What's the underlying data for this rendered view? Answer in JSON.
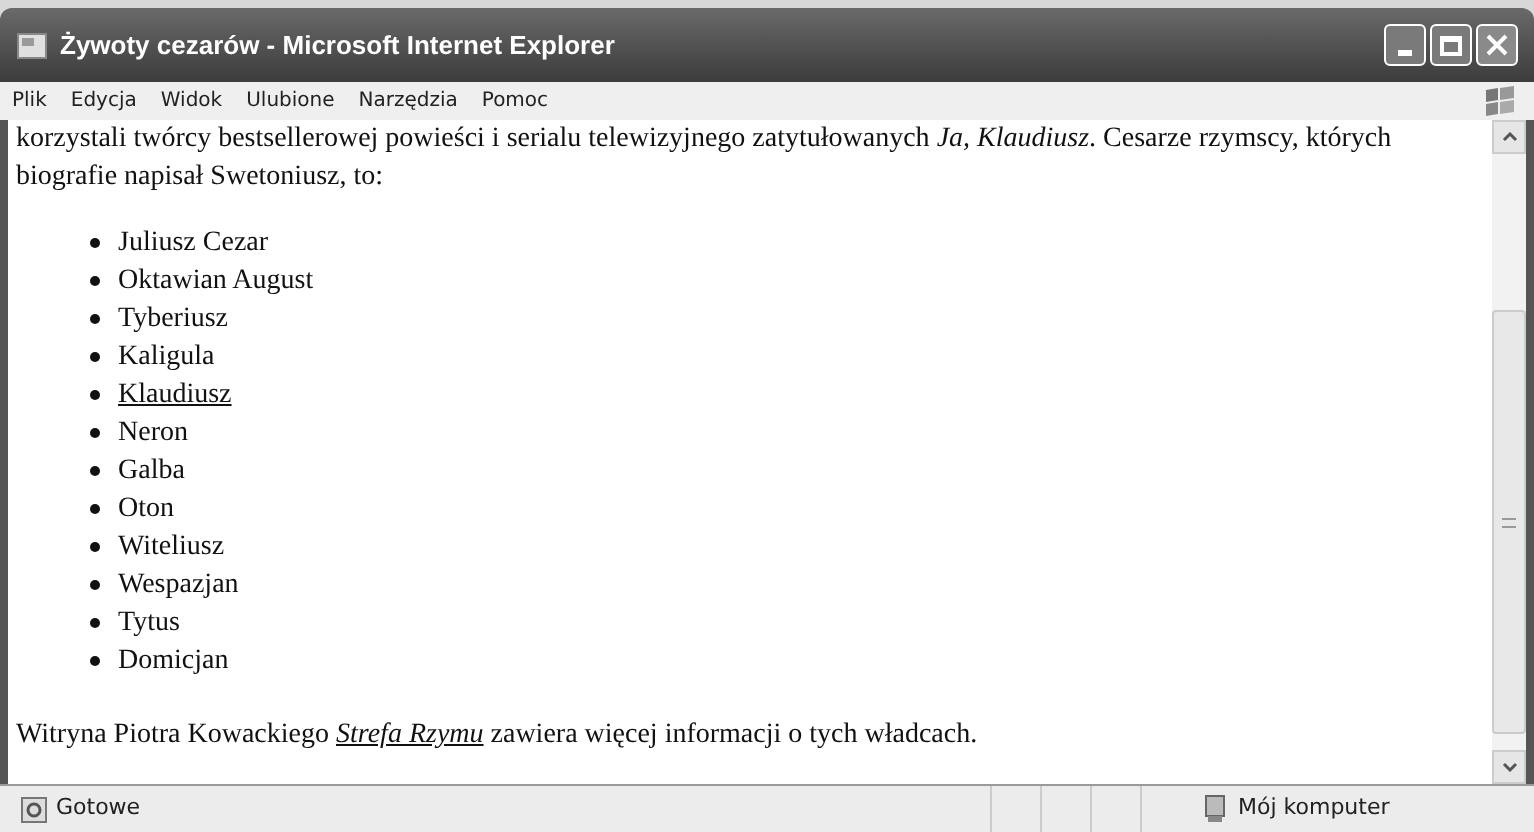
{
  "window": {
    "title": "Żywoty cezarów - Microsoft Internet Explorer"
  },
  "menu": [
    "Plik",
    "Edycja",
    "Widok",
    "Ulubione",
    "Narzędzia",
    "Pomoc"
  ],
  "content": {
    "intro": "korzystali twórcy bestsellerowej powieści i serialu telewizyjnego zatytułowanych *Ja, Klaudiusz*. Cesarze rzymscy, których biografie napisał Swetoniusz, to:",
    "emperors": [
      {
        "name": "Juliusz Cezar",
        "link": false
      },
      {
        "name": "Oktawian August",
        "link": false
      },
      {
        "name": "Tyberiusz",
        "link": false
      },
      {
        "name": "Kaligula",
        "link": false
      },
      {
        "name": "Klaudiusz",
        "link": true
      },
      {
        "name": "Neron",
        "link": false
      },
      {
        "name": "Galba",
        "link": false
      },
      {
        "name": "Oton",
        "link": false
      },
      {
        "name": "Witeliusz",
        "link": false
      },
      {
        "name": "Wespazjan",
        "link": false
      },
      {
        "name": "Tytus",
        "link": false
      },
      {
        "name": "Domicjan",
        "link": false
      }
    ],
    "footer": {
      "before": "Witryna Piotra Kowackiego ",
      "link": "Strefa Rzymu",
      "after": " zawiera więcej informacji o tych władcach."
    }
  },
  "status_bar": {
    "status": "Gotowe",
    "zone": "Mój komputer"
  }
}
